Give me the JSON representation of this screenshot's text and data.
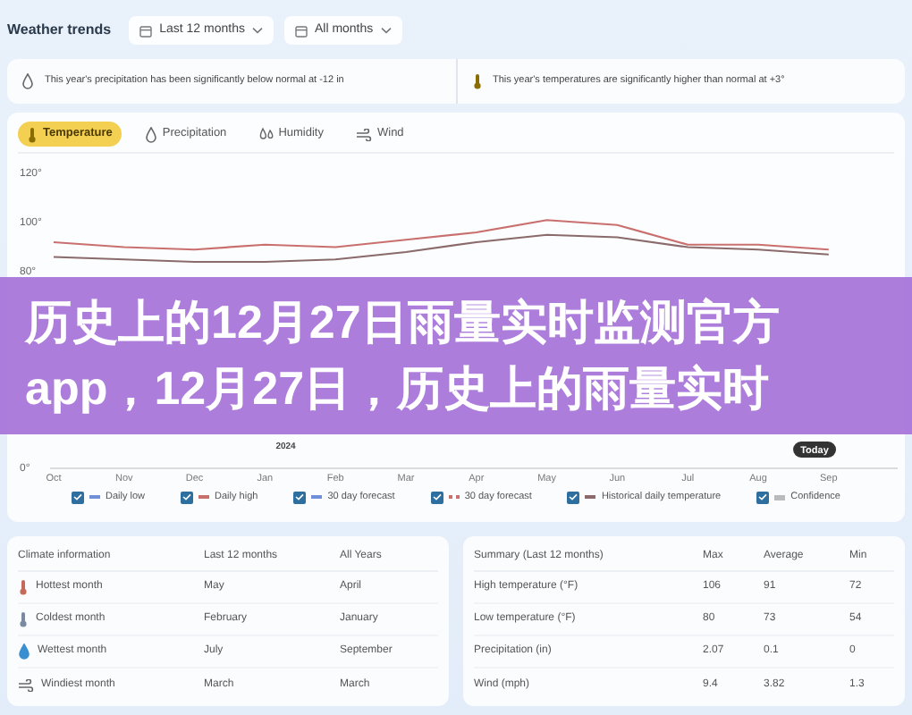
{
  "header": {
    "title": "Weather trends",
    "filters": [
      {
        "label": "Last 12 months"
      },
      {
        "label": "All months"
      }
    ]
  },
  "insights": [
    {
      "kind": "rain",
      "text": "This year's precipitation has been significantly below normal at -12 in"
    },
    {
      "kind": "temp",
      "text": "This year's temperatures are significantly higher than normal at +3°"
    }
  ],
  "tabs": [
    {
      "kind": "temp",
      "label": "Temperature",
      "selected": true
    },
    {
      "kind": "rain",
      "label": "Precipitation",
      "selected": false
    },
    {
      "kind": "humidity",
      "label": "Humidity",
      "selected": false
    },
    {
      "kind": "wind",
      "label": "Wind",
      "selected": false
    }
  ],
  "chart": {
    "year_label": "2024",
    "today_label": "Today",
    "chart_data": {
      "type": "line",
      "categories": [
        "Oct",
        "Nov",
        "Dec",
        "Jan",
        "Feb",
        "Mar",
        "Apr",
        "May",
        "Jun",
        "Jul",
        "Aug",
        "Sep"
      ],
      "ylim": [
        0,
        120
      ],
      "yticks": [
        {
          "value": 0,
          "label": "0°"
        },
        {
          "value": 80,
          "label": "80°"
        },
        {
          "value": 100,
          "label": "100°"
        },
        {
          "value": 120,
          "label": "120°"
        }
      ],
      "series": [
        {
          "color": "#c9706f",
          "values": [
            92,
            90,
            89,
            91,
            90,
            93,
            96,
            101,
            99,
            91,
            91,
            89
          ]
        },
        {
          "color": "#8a6a6a",
          "values": [
            86,
            85,
            84,
            84,
            85,
            88,
            92,
            95,
            94,
            90,
            89,
            87
          ]
        }
      ]
    }
  },
  "legend": [
    {
      "kind": "solid",
      "color": "#6f8fd8",
      "label": "Daily low",
      "checked": true
    },
    {
      "kind": "solid",
      "color": "#c9706f",
      "label": "Daily high",
      "checked": true
    },
    {
      "kind": "dashed",
      "color": "#6f8fd8",
      "label": "30 day forecast",
      "checked": true
    },
    {
      "kind": "dotted",
      "color": "#c9706f",
      "label": "30 day forecast",
      "checked": true
    },
    {
      "kind": "solid",
      "color": "#8a6a6a",
      "label": "Historical daily temperature",
      "checked": true
    },
    {
      "kind": "band",
      "color": "#bbbbbb",
      "label": "Confidence",
      "checked": true
    }
  ],
  "banner": {
    "lines": [
      "历史上的12月27日雨量实时监测官方",
      "app，12月27日，历史上的雨量实时"
    ]
  },
  "climate_table": {
    "columns": [
      "Climate information",
      "Last 12 months",
      "All Years"
    ],
    "rows": [
      {
        "kind": "hot",
        "cells": [
          "Hottest month",
          "May",
          "April"
        ]
      },
      {
        "kind": "cold",
        "cells": [
          "Coldest month",
          "February",
          "January"
        ]
      },
      {
        "kind": "wet",
        "cells": [
          "Wettest month",
          "July",
          "September"
        ]
      },
      {
        "kind": "wind",
        "cells": [
          "Windiest month",
          "March",
          "March"
        ]
      }
    ]
  },
  "summary_table": {
    "columns": [
      "Summary (Last 12 months)",
      "Max",
      "Average",
      "Min"
    ],
    "rows": [
      {
        "cells": [
          "High temperature (°F)",
          "106",
          "91",
          "72"
        ]
      },
      {
        "cells": [
          "Low temperature (°F)",
          "80",
          "73",
          "54"
        ]
      },
      {
        "cells": [
          "Precipitation (in)",
          "2.07",
          "0.1",
          "0"
        ]
      },
      {
        "cells": [
          "Wind (mph)",
          "9.4",
          "3.82",
          "1.3"
        ]
      }
    ]
  }
}
